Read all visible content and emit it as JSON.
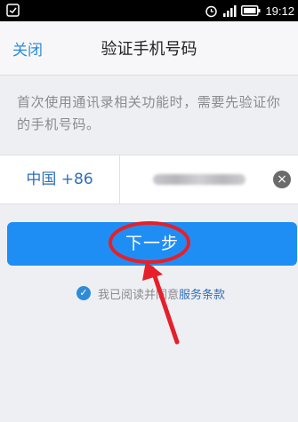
{
  "status_bar": {
    "time": "19:12"
  },
  "header": {
    "close_label": "关闭",
    "title": "验证手机号码"
  },
  "tip": "首次使用通讯录相关功能时，需要先验证你的手机号码。",
  "phone": {
    "country_code": "中国 +86"
  },
  "next_button_label": "下一步",
  "agreement": {
    "prefix": "我已阅读并同意",
    "terms_link": "服务条款"
  },
  "colors": {
    "accent": "#1f8ef4",
    "link": "#2e6fb8",
    "annotation": "#e5202a"
  }
}
